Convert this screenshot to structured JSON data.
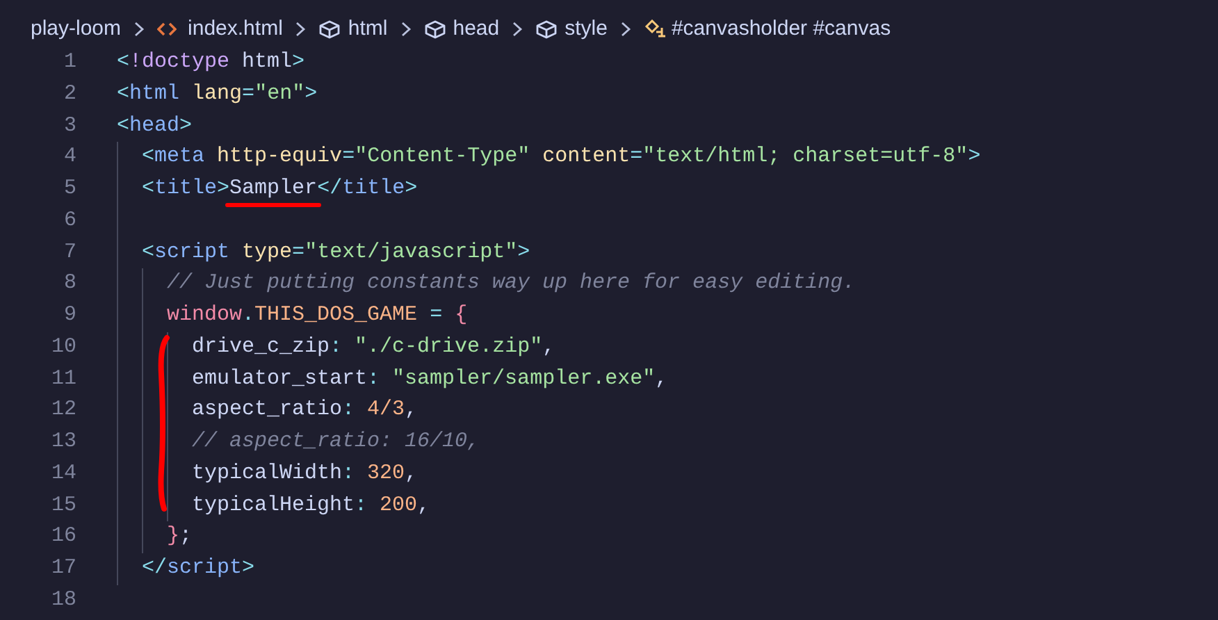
{
  "breadcrumb": [
    {
      "label": "play-loom",
      "kind": "folder"
    },
    {
      "label": "index.html",
      "kind": "file"
    },
    {
      "label": "html",
      "kind": "element"
    },
    {
      "label": "head",
      "kind": "element"
    },
    {
      "label": "style",
      "kind": "element"
    },
    {
      "label": "#canvasholder #canvas",
      "kind": "selector"
    }
  ],
  "editor": {
    "lines": [
      {
        "number": "1",
        "tokens": [
          {
            "text": "<",
            "kind": "punct"
          },
          {
            "text": "!doctype",
            "kind": "keyword"
          },
          {
            "text": " html",
            "kind": "plain"
          },
          {
            "text": ">",
            "kind": "punct"
          }
        ]
      },
      {
        "number": "2",
        "tokens": [
          {
            "text": "<",
            "kind": "punct"
          },
          {
            "text": "html",
            "kind": "tag"
          },
          {
            "text": " lang",
            "kind": "attr"
          },
          {
            "text": "=",
            "kind": "punct"
          },
          {
            "text": "\"en\"",
            "kind": "string"
          },
          {
            "text": ">",
            "kind": "punct"
          }
        ]
      },
      {
        "number": "3",
        "tokens": [
          {
            "text": "<",
            "kind": "punct"
          },
          {
            "text": "head",
            "kind": "tag"
          },
          {
            "text": ">",
            "kind": "punct"
          }
        ],
        "children": [
          {
            "number": "4",
            "tokens": [
              {
                "text": "<",
                "kind": "punct"
              },
              {
                "text": "meta",
                "kind": "tag"
              },
              {
                "text": " http-equiv",
                "kind": "attr"
              },
              {
                "text": "=",
                "kind": "punct"
              },
              {
                "text": "\"Content-Type\"",
                "kind": "string"
              },
              {
                "text": " content",
                "kind": "attr"
              },
              {
                "text": "=",
                "kind": "punct"
              },
              {
                "text": "\"text/html; charset=utf-8\"",
                "kind": "string"
              },
              {
                "text": ">",
                "kind": "punct"
              }
            ]
          },
          {
            "number": "5",
            "tokens": [
              {
                "text": "<",
                "kind": "punct"
              },
              {
                "text": "title",
                "kind": "tag"
              },
              {
                "text": ">",
                "kind": "punct"
              },
              {
                "text": "Sampler",
                "kind": "plain",
                "underlined": true
              },
              {
                "text": "</",
                "kind": "punct"
              },
              {
                "text": "title",
                "kind": "tag"
              },
              {
                "text": ">",
                "kind": "punct"
              }
            ]
          },
          {
            "number": "6"
          },
          {
            "number": "7",
            "tokens": [
              {
                "text": "<",
                "kind": "punct"
              },
              {
                "text": "script",
                "kind": "tag"
              },
              {
                "text": " type",
                "kind": "attr"
              },
              {
                "text": "=",
                "kind": "punct"
              },
              {
                "text": "\"text/javascript\"",
                "kind": "string"
              },
              {
                "text": ">",
                "kind": "punct"
              }
            ],
            "children": [
              {
                "number": "8",
                "tokens": [
                  {
                    "text": "// Just putting constants way up here for easy editing.",
                    "kind": "comment"
                  }
                ]
              },
              {
                "number": "9",
                "tokens": [
                  {
                    "text": "window",
                    "kind": "variable"
                  },
                  {
                    "text": ".",
                    "kind": "punct"
                  },
                  {
                    "text": "THIS_DOS_GAME",
                    "kind": "constant"
                  },
                  {
                    "text": " = ",
                    "kind": "punct"
                  },
                  {
                    "text": "{",
                    "kind": "variable"
                  }
                ],
                "children": [
                  {
                    "number": "10",
                    "tokens": [
                      {
                        "text": "drive_c_zip",
                        "kind": "plain"
                      },
                      {
                        "text": ": ",
                        "kind": "punct"
                      },
                      {
                        "text": "\"./c-drive.zip\"",
                        "kind": "string"
                      },
                      {
                        "text": ",",
                        "kind": "plain"
                      }
                    ]
                  },
                  {
                    "number": "11",
                    "tokens": [
                      {
                        "text": "emulator_start",
                        "kind": "plain"
                      },
                      {
                        "text": ": ",
                        "kind": "punct"
                      },
                      {
                        "text": "\"sampler/sampler.exe\"",
                        "kind": "string"
                      },
                      {
                        "text": ",",
                        "kind": "plain"
                      }
                    ]
                  },
                  {
                    "number": "12",
                    "tokens": [
                      {
                        "text": "aspect_ratio",
                        "kind": "plain"
                      },
                      {
                        "text": ": ",
                        "kind": "punct"
                      },
                      {
                        "text": "4/3",
                        "kind": "number"
                      },
                      {
                        "text": ",",
                        "kind": "plain"
                      }
                    ]
                  },
                  {
                    "number": "13",
                    "tokens": [
                      {
                        "text": "// aspect_ratio: 16/10,",
                        "kind": "comment"
                      }
                    ]
                  },
                  {
                    "number": "14",
                    "tokens": [
                      {
                        "text": "typicalWidth",
                        "kind": "plain"
                      },
                      {
                        "text": ": ",
                        "kind": "punct"
                      },
                      {
                        "text": "320",
                        "kind": "number"
                      },
                      {
                        "text": ",",
                        "kind": "plain"
                      }
                    ]
                  },
                  {
                    "number": "15",
                    "tokens": [
                      {
                        "text": "typicalHeight",
                        "kind": "plain"
                      },
                      {
                        "text": ": ",
                        "kind": "punct"
                      },
                      {
                        "text": "200",
                        "kind": "number"
                      },
                      {
                        "text": ",",
                        "kind": "plain"
                      }
                    ]
                  }
                ]
              },
              {
                "number": "16",
                "tokens": [
                  {
                    "text": "}",
                    "kind": "variable"
                  },
                  {
                    "text": ";",
                    "kind": "plain"
                  }
                ]
              }
            ]
          },
          {
            "number": "17",
            "tokens": [
              {
                "text": "</",
                "kind": "punct"
              },
              {
                "text": "script",
                "kind": "tag"
              },
              {
                "text": ">",
                "kind": "punct"
              }
            ]
          }
        ]
      },
      {
        "number": "18"
      }
    ]
  },
  "annotations": [
    {
      "kind": "bracket"
    }
  ]
}
